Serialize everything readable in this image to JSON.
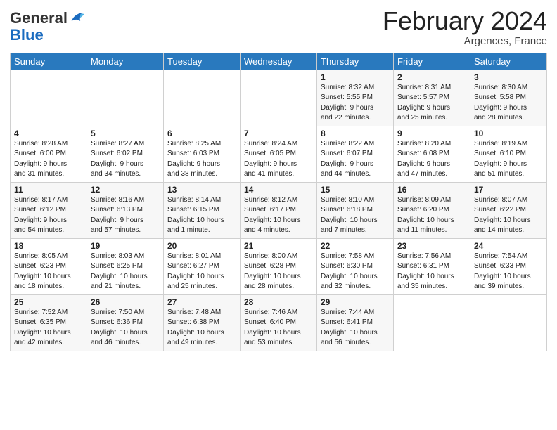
{
  "header": {
    "logo_general": "General",
    "logo_blue": "Blue",
    "month_title": "February 2024",
    "location": "Argences, France"
  },
  "days_of_week": [
    "Sunday",
    "Monday",
    "Tuesday",
    "Wednesday",
    "Thursday",
    "Friday",
    "Saturday"
  ],
  "weeks": [
    [
      {
        "day": "",
        "info": ""
      },
      {
        "day": "",
        "info": ""
      },
      {
        "day": "",
        "info": ""
      },
      {
        "day": "",
        "info": ""
      },
      {
        "day": "1",
        "info": "Sunrise: 8:32 AM\nSunset: 5:55 PM\nDaylight: 9 hours\nand 22 minutes."
      },
      {
        "day": "2",
        "info": "Sunrise: 8:31 AM\nSunset: 5:57 PM\nDaylight: 9 hours\nand 25 minutes."
      },
      {
        "day": "3",
        "info": "Sunrise: 8:30 AM\nSunset: 5:58 PM\nDaylight: 9 hours\nand 28 minutes."
      }
    ],
    [
      {
        "day": "4",
        "info": "Sunrise: 8:28 AM\nSunset: 6:00 PM\nDaylight: 9 hours\nand 31 minutes."
      },
      {
        "day": "5",
        "info": "Sunrise: 8:27 AM\nSunset: 6:02 PM\nDaylight: 9 hours\nand 34 minutes."
      },
      {
        "day": "6",
        "info": "Sunrise: 8:25 AM\nSunset: 6:03 PM\nDaylight: 9 hours\nand 38 minutes."
      },
      {
        "day": "7",
        "info": "Sunrise: 8:24 AM\nSunset: 6:05 PM\nDaylight: 9 hours\nand 41 minutes."
      },
      {
        "day": "8",
        "info": "Sunrise: 8:22 AM\nSunset: 6:07 PM\nDaylight: 9 hours\nand 44 minutes."
      },
      {
        "day": "9",
        "info": "Sunrise: 8:20 AM\nSunset: 6:08 PM\nDaylight: 9 hours\nand 47 minutes."
      },
      {
        "day": "10",
        "info": "Sunrise: 8:19 AM\nSunset: 6:10 PM\nDaylight: 9 hours\nand 51 minutes."
      }
    ],
    [
      {
        "day": "11",
        "info": "Sunrise: 8:17 AM\nSunset: 6:12 PM\nDaylight: 9 hours\nand 54 minutes."
      },
      {
        "day": "12",
        "info": "Sunrise: 8:16 AM\nSunset: 6:13 PM\nDaylight: 9 hours\nand 57 minutes."
      },
      {
        "day": "13",
        "info": "Sunrise: 8:14 AM\nSunset: 6:15 PM\nDaylight: 10 hours\nand 1 minute."
      },
      {
        "day": "14",
        "info": "Sunrise: 8:12 AM\nSunset: 6:17 PM\nDaylight: 10 hours\nand 4 minutes."
      },
      {
        "day": "15",
        "info": "Sunrise: 8:10 AM\nSunset: 6:18 PM\nDaylight: 10 hours\nand 7 minutes."
      },
      {
        "day": "16",
        "info": "Sunrise: 8:09 AM\nSunset: 6:20 PM\nDaylight: 10 hours\nand 11 minutes."
      },
      {
        "day": "17",
        "info": "Sunrise: 8:07 AM\nSunset: 6:22 PM\nDaylight: 10 hours\nand 14 minutes."
      }
    ],
    [
      {
        "day": "18",
        "info": "Sunrise: 8:05 AM\nSunset: 6:23 PM\nDaylight: 10 hours\nand 18 minutes."
      },
      {
        "day": "19",
        "info": "Sunrise: 8:03 AM\nSunset: 6:25 PM\nDaylight: 10 hours\nand 21 minutes."
      },
      {
        "day": "20",
        "info": "Sunrise: 8:01 AM\nSunset: 6:27 PM\nDaylight: 10 hours\nand 25 minutes."
      },
      {
        "day": "21",
        "info": "Sunrise: 8:00 AM\nSunset: 6:28 PM\nDaylight: 10 hours\nand 28 minutes."
      },
      {
        "day": "22",
        "info": "Sunrise: 7:58 AM\nSunset: 6:30 PM\nDaylight: 10 hours\nand 32 minutes."
      },
      {
        "day": "23",
        "info": "Sunrise: 7:56 AM\nSunset: 6:31 PM\nDaylight: 10 hours\nand 35 minutes."
      },
      {
        "day": "24",
        "info": "Sunrise: 7:54 AM\nSunset: 6:33 PM\nDaylight: 10 hours\nand 39 minutes."
      }
    ],
    [
      {
        "day": "25",
        "info": "Sunrise: 7:52 AM\nSunset: 6:35 PM\nDaylight: 10 hours\nand 42 minutes."
      },
      {
        "day": "26",
        "info": "Sunrise: 7:50 AM\nSunset: 6:36 PM\nDaylight: 10 hours\nand 46 minutes."
      },
      {
        "day": "27",
        "info": "Sunrise: 7:48 AM\nSunset: 6:38 PM\nDaylight: 10 hours\nand 49 minutes."
      },
      {
        "day": "28",
        "info": "Sunrise: 7:46 AM\nSunset: 6:40 PM\nDaylight: 10 hours\nand 53 minutes."
      },
      {
        "day": "29",
        "info": "Sunrise: 7:44 AM\nSunset: 6:41 PM\nDaylight: 10 hours\nand 56 minutes."
      },
      {
        "day": "",
        "info": ""
      },
      {
        "day": "",
        "info": ""
      }
    ]
  ]
}
